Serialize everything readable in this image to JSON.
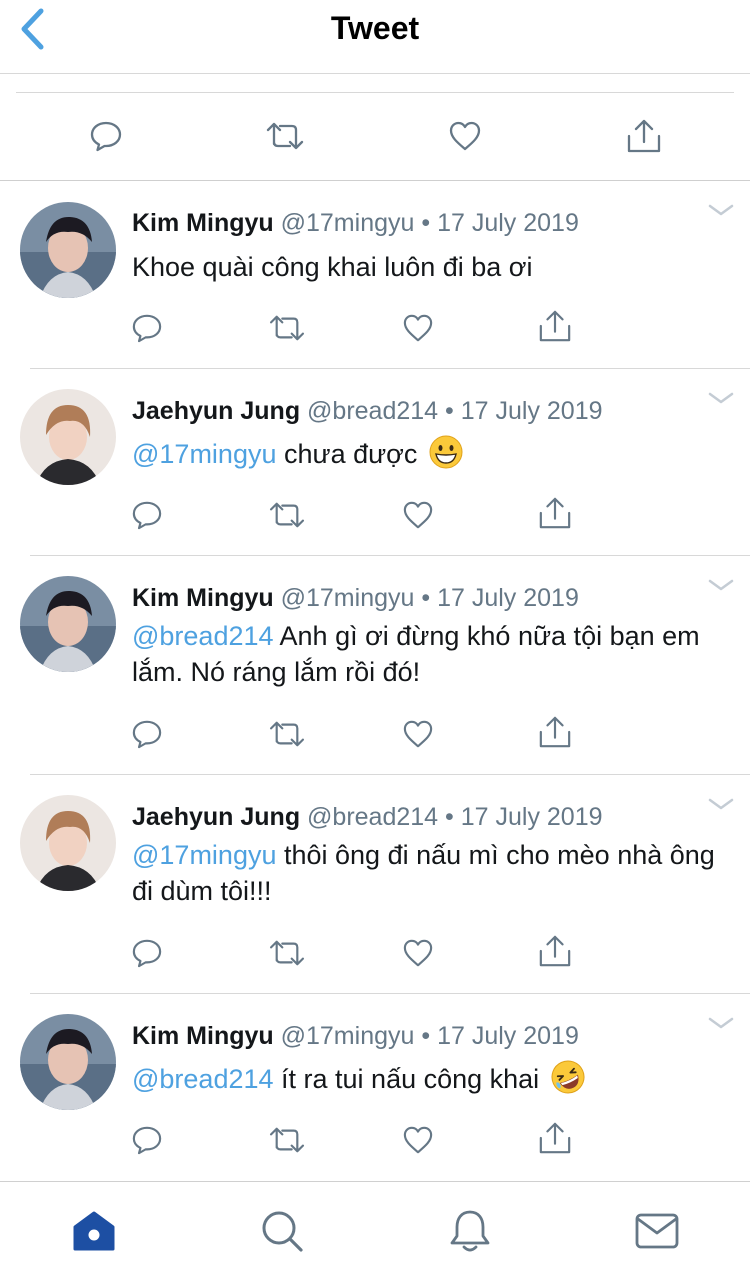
{
  "header": {
    "title": "Tweet",
    "back_icon": "chevron-left-icon"
  },
  "colors": {
    "accent": "#4ea1e0",
    "icon_gray": "#657786",
    "tab_active": "#1d4fa3"
  },
  "main_actions": [
    "reply-icon",
    "retweet-icon",
    "like-icon",
    "share-icon"
  ],
  "replies": [
    {
      "name": "Kim Mingyu",
      "handle": "@17mingyu",
      "sep": "•",
      "date": "17 July 2019",
      "mention": "",
      "text": "Khoe quài công khai luôn đi ba ơi",
      "emoji": ""
    },
    {
      "name": "Jaehyun Jung",
      "handle": "@bread214",
      "sep": "•",
      "date": "17 July 2019",
      "mention": "@17mingyu",
      "text": " chưa được",
      "emoji": "grinning-face-emoji"
    },
    {
      "name": "Kim Mingyu",
      "handle": "@17mingyu",
      "sep": "•",
      "date": "17 July 2019",
      "mention": "@bread214",
      "text": " Anh gì ơi đừng khó nữa tội bạn em lắm. Nó ráng lắm rồi đó!",
      "emoji": ""
    },
    {
      "name": "Jaehyun Jung",
      "handle": "@bread214",
      "sep": "•",
      "date": "17 July 2019",
      "mention": "@17mingyu",
      "text": " thôi ông đi nấu mì cho mèo nhà ông đi dùm tôi!!!",
      "emoji": ""
    },
    {
      "name": "Kim Mingyu",
      "handle": "@17mingyu",
      "sep": "•",
      "date": "17 July 2019",
      "mention": "@bread214",
      "text": " ít ra tui nấu công khai",
      "emoji": "rolling-laughing-emoji"
    }
  ],
  "tabbar": [
    "home-icon",
    "search-icon",
    "notifications-icon",
    "messages-icon"
  ]
}
